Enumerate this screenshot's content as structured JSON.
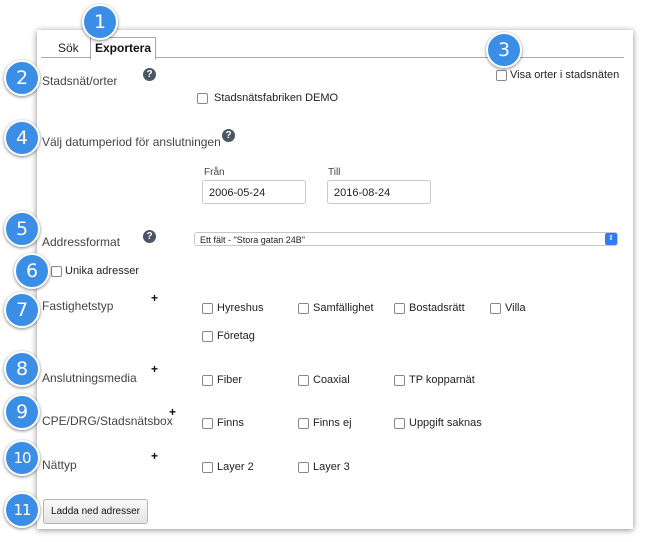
{
  "tabs": [
    {
      "label": "Sök",
      "active": false
    },
    {
      "label": "Exportera",
      "active": true
    }
  ],
  "badges": [
    "1",
    "2",
    "3",
    "4",
    "5",
    "6",
    "7",
    "8",
    "9",
    "10",
    "11"
  ],
  "colors": {
    "badge": "#3a8ee6",
    "select_arrow": "#2f7df0"
  },
  "stadsnat": {
    "label": "Stadsnät/orter",
    "option": "Stadsnätsfabriken DEMO",
    "show_towns_label": "Visa orter i stadsnäten"
  },
  "datum": {
    "label": "Välj datumperiod för anslutningen",
    "from_label": "Från",
    "from_value": "2006-05-24",
    "to_label": "Till",
    "to_value": "2016-08-24"
  },
  "addressformat": {
    "label": "Addressformat",
    "selected": "Ett fält - \"Stora gatan 24B\""
  },
  "unika": {
    "label": "Unika adresser"
  },
  "fastighetstyp": {
    "label": "Fastighetstyp",
    "options": [
      "Hyreshus",
      "Samfällighet",
      "Bostadsrätt",
      "Villa",
      "Företag"
    ]
  },
  "anslutningsmedia": {
    "label": "Anslutningsmedia",
    "options": [
      "Fiber",
      "Coaxial",
      "TP kopparnät"
    ]
  },
  "cpe": {
    "label": "CPE/DRG/Stadsnätsbox",
    "options": [
      "Finns",
      "Finns ej",
      "Uppgift saknas"
    ]
  },
  "nattyp": {
    "label": "Nättyp",
    "options": [
      "Layer 2",
      "Layer 3"
    ]
  },
  "download_button": "Ladda ned adresser",
  "help_icon": "?",
  "plus_icon": "+"
}
